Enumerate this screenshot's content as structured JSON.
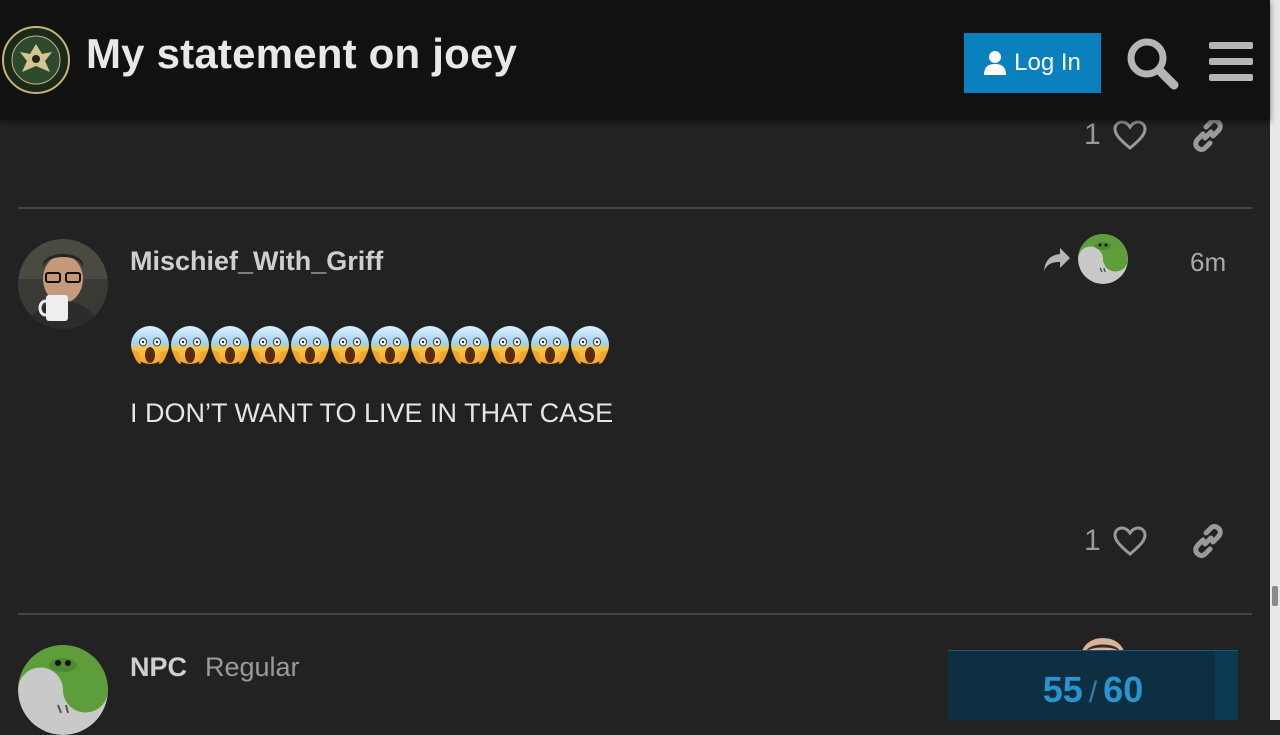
{
  "header": {
    "title": "My statement on joey",
    "login_label": "Log In",
    "logo_text": "INFOWARS ARMY"
  },
  "posts": [
    {
      "likes": "1"
    },
    {
      "username": "Mischief_With_Griff",
      "date": "6m",
      "emoji_count": 12,
      "text": "I DON’T WANT TO LIVE IN THAT CASE",
      "likes": "1"
    },
    {
      "username": "NPC",
      "user_title": "Regular"
    }
  ],
  "progress": {
    "current": "55",
    "total": "60",
    "fraction": 0.9167
  },
  "colors": {
    "header_bg": "#111111",
    "page_bg": "#222222",
    "accent": "#0a80be",
    "progress_text": "#2a94cf"
  },
  "icons": [
    "user-icon",
    "search-icon",
    "hamburger-menu-icon",
    "heart-icon",
    "link-icon",
    "reply-arrow-icon",
    "scream-emoji-icon"
  ]
}
